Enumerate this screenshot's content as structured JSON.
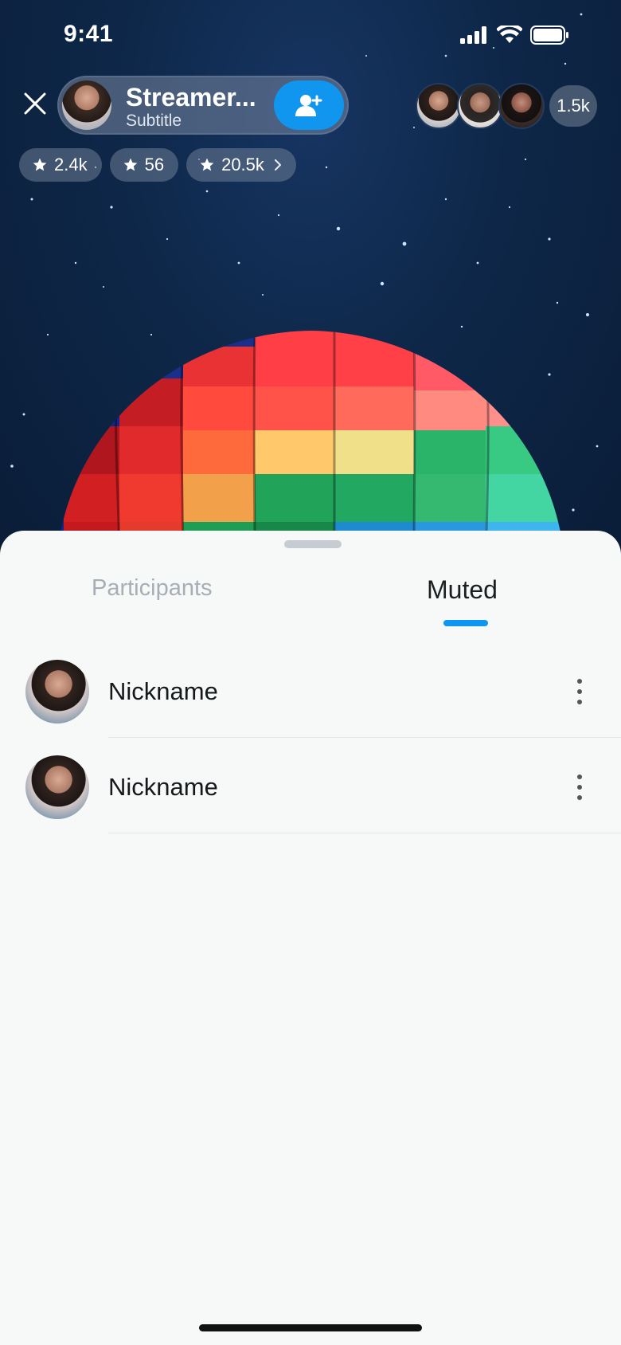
{
  "status_bar": {
    "time": "9:41"
  },
  "header": {
    "streamer_name": "Streamer...",
    "streamer_subtitle": "Subtitle",
    "viewer_count": "1.5k",
    "stats": [
      {
        "icon": "star-icon",
        "value": "2.4k"
      },
      {
        "icon": "star-icon",
        "value": "56"
      },
      {
        "icon": "star-icon",
        "value": "20.5k"
      }
    ]
  },
  "sheet": {
    "tabs": [
      {
        "label": "Participants",
        "active": false
      },
      {
        "label": "Muted",
        "active": true
      }
    ],
    "rows": [
      {
        "nickname": "Nickname"
      },
      {
        "nickname": "Nickname"
      }
    ]
  },
  "colors": {
    "accent": "#1196F0",
    "sheet_bg": "#F7F9F9",
    "inactive_tab": "#A7AEB5"
  }
}
